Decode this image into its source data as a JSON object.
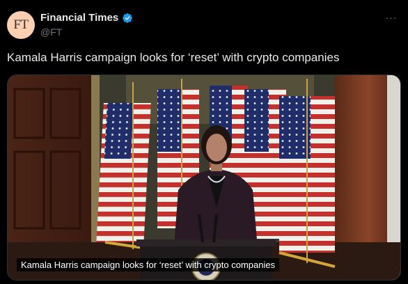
{
  "account": {
    "avatar_text": "FT",
    "display_name": "Financial Times",
    "handle": "@FT",
    "verified_icon": "verified-badge-icon",
    "avatar_color": "#fcd0b1"
  },
  "menu": {
    "more_label": "···"
  },
  "tweet": {
    "text": "Kamala Harris campaign looks for ‘reset’ with crypto companies"
  },
  "media": {
    "caption": "Kamala Harris campaign looks for ‘reset’ with crypto companies"
  },
  "colors": {
    "background": "#000000",
    "text_primary": "#e7e9ea",
    "text_secondary": "#71767b",
    "verified_blue": "#1d9bf0"
  }
}
